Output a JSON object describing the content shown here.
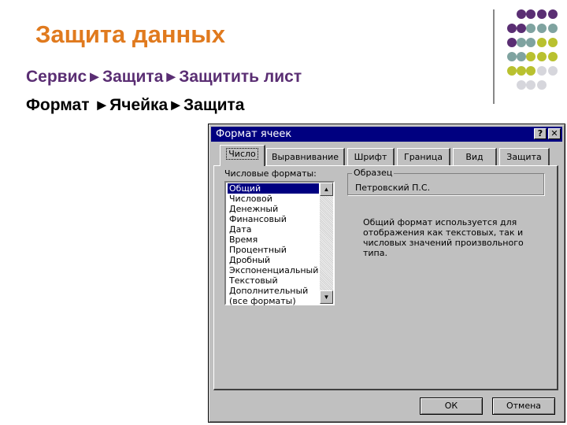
{
  "slide": {
    "title": "Защита данных",
    "line1": {
      "a": "Сервис",
      "b": "Защита",
      "c": "Защитить лист"
    },
    "line2": {
      "a": "Формат ",
      "b": "Ячейка",
      "c": "Защита"
    },
    "arrow": "►"
  },
  "decor": {
    "dot_colors": [
      "#5a2e73",
      "#7fa3a0",
      "#b9c12f",
      "#d6d6dc"
    ]
  },
  "dialog": {
    "title": "Формат ячеек",
    "help_button": "?",
    "close_button": "✕",
    "tabs": [
      "Число",
      "Выравнивание",
      "Шрифт",
      "Граница",
      "Вид",
      "Защита"
    ],
    "active_tab": "Число",
    "formats_label": "Числовые форматы:",
    "formats": [
      "Общий",
      "Числовой",
      "Денежный",
      "Финансовый",
      "Дата",
      "Время",
      "Процентный",
      "Дробный",
      "Экспоненциальный",
      "Текстовый",
      "Дополнительный",
      "(все форматы)"
    ],
    "selected_format": "Общий",
    "sample_label": "Образец",
    "sample_value": "Петровский П.С.",
    "description": "Общий формат используется для отображения как текстовых, так и числовых значений произвольного типа.",
    "ok_label": "ОК",
    "cancel_label": "Отмена"
  }
}
